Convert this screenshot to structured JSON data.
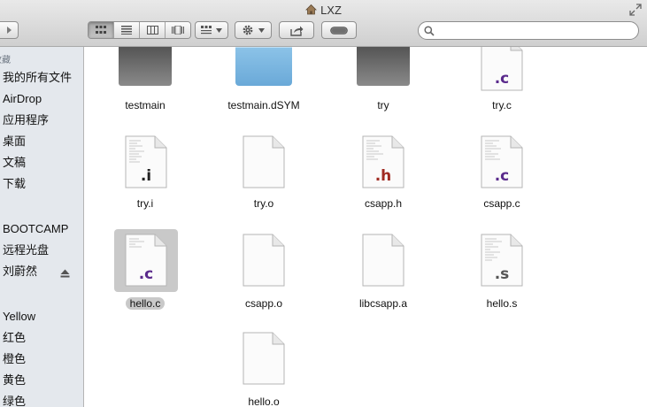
{
  "window": {
    "title": "LXZ"
  },
  "search": {
    "placeholder": "",
    "value": ""
  },
  "toolbar": {
    "view_icons": "icon-view-icon",
    "view_list": "list-view-icon",
    "view_columns": "column-view-icon",
    "view_coverflow": "coverflow-view-icon",
    "arrange": "arrange-icon",
    "action": "gear-icon",
    "share": "share-icon",
    "tag": "tag-toggle-icon"
  },
  "sidebar": {
    "favorites_header": "收藏",
    "favorites": [
      "我的所有文件",
      "AirDrop",
      "应用程序",
      "桌面",
      "文稿",
      "下载"
    ],
    "devices": [
      "BOOTCAMP",
      "远程光盘",
      "刘蔚然"
    ],
    "tags": [
      "Yellow",
      "红色",
      "橙色",
      "黄色",
      "绿色"
    ]
  },
  "files": [
    {
      "name": "testmain",
      "kind": "folder-grey"
    },
    {
      "name": "testmain.dSYM",
      "kind": "folder-blue"
    },
    {
      "name": "try",
      "kind": "folder-grey"
    },
    {
      "name": "try.c",
      "kind": "doc",
      "ext": ".c",
      "ext_color": "#5a2a8c"
    },
    {
      "name": "try.i",
      "kind": "doc-lines",
      "ext": ".i",
      "ext_color": "#222222"
    },
    {
      "name": "try.o",
      "kind": "doc-blank"
    },
    {
      "name": "csapp.h",
      "kind": "doc-lines",
      "ext": ".h",
      "ext_color": "#a02b22"
    },
    {
      "name": "csapp.c",
      "kind": "doc-lines",
      "ext": ".c",
      "ext_color": "#5a2a8c"
    },
    {
      "name": "hello.c",
      "kind": "doc-lines",
      "ext": ".c",
      "ext_color": "#5a2a8c",
      "selected": true
    },
    {
      "name": "csapp.o",
      "kind": "doc-blank"
    },
    {
      "name": "libcsapp.a",
      "kind": "doc-blank"
    },
    {
      "name": "hello.s",
      "kind": "doc-lines",
      "ext": ".s",
      "ext_color": "#555555"
    },
    {
      "name": "hello.o",
      "kind": "doc-blank"
    }
  ]
}
